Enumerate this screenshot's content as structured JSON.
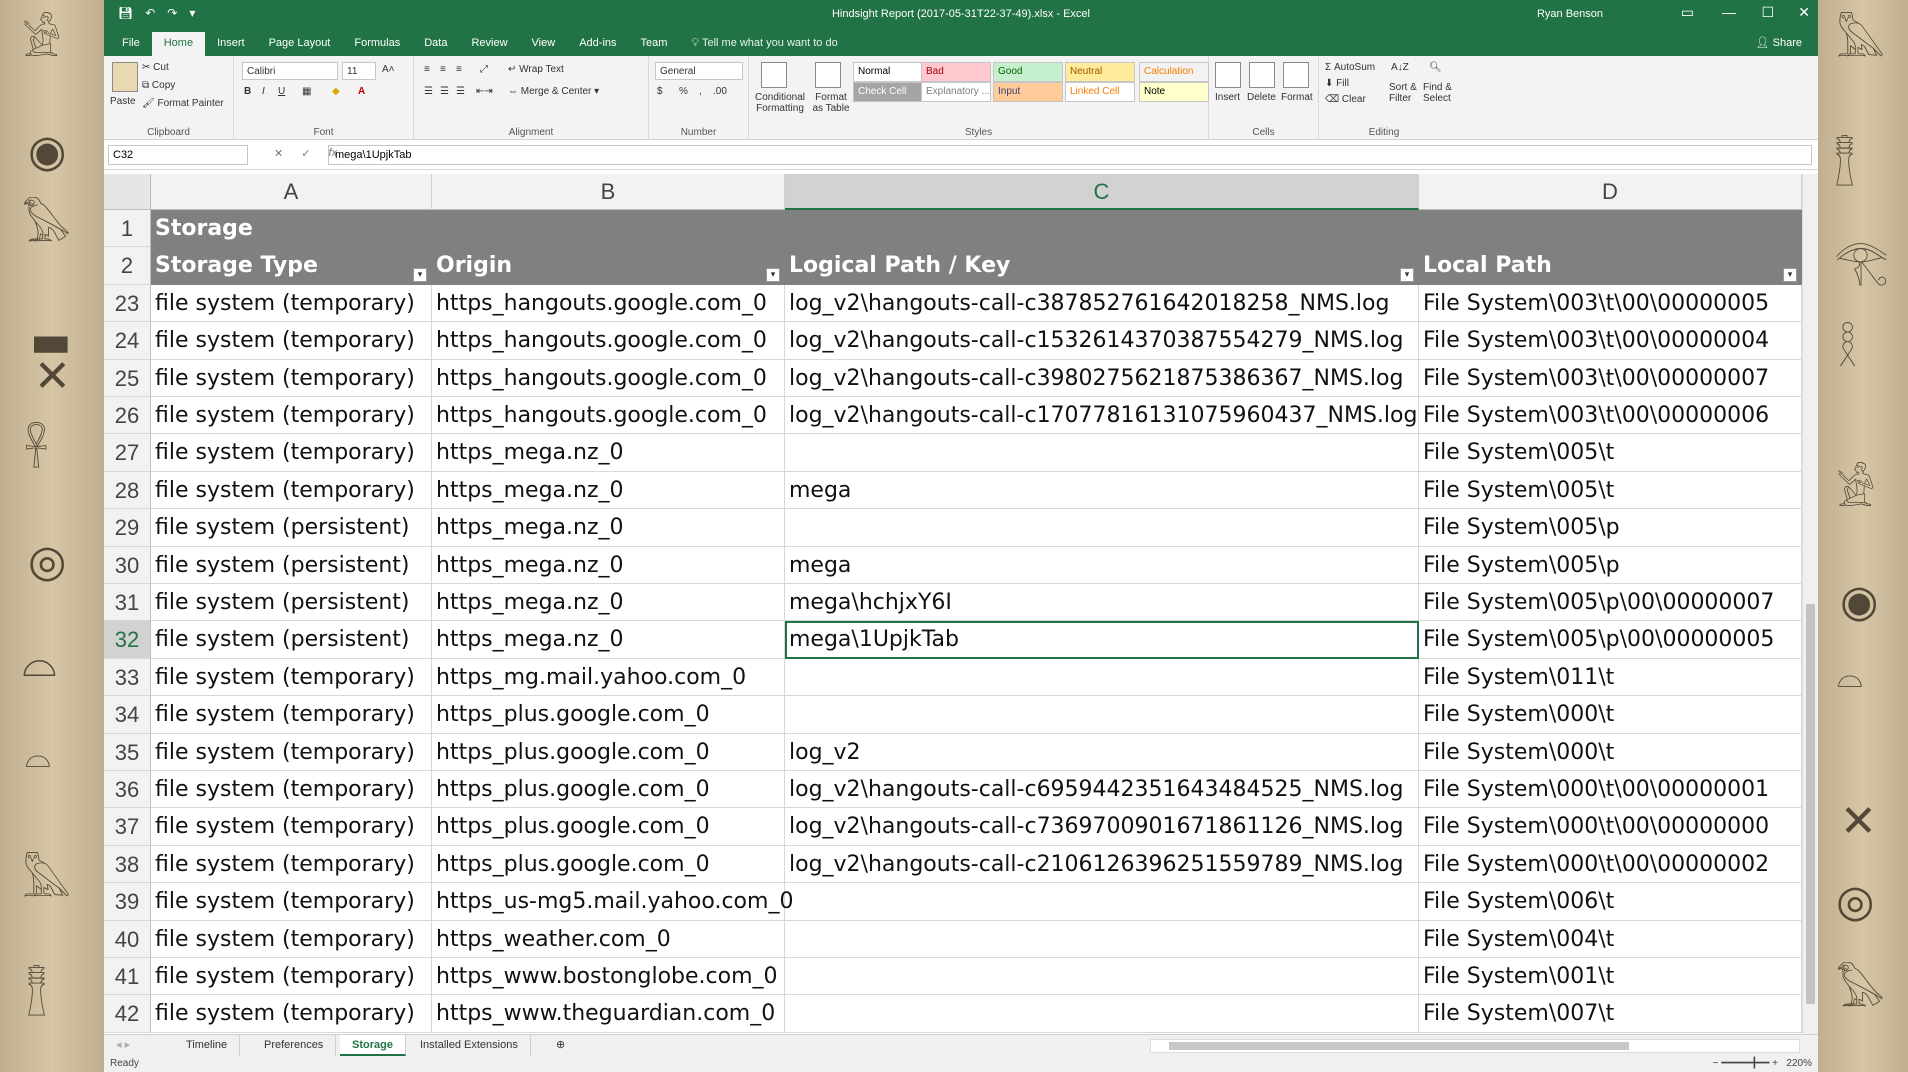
{
  "window": {
    "title": "Hindsight Report (2017-05-31T22-37-49).xlsx - Excel",
    "user": "Ryan Benson",
    "controls": [
      "—",
      "☐",
      "✕"
    ]
  },
  "ribbon_tabs": [
    "File",
    "Home",
    "Insert",
    "Page Layout",
    "Formulas",
    "Data",
    "Review",
    "View",
    "Add-ins",
    "Team"
  ],
  "tell_me": "Tell me what you want to do",
  "share": "Share",
  "clipboard": {
    "paste": "Paste",
    "cut": "Cut",
    "copy": "Copy",
    "format_painter": "Format Painter",
    "label": "Clipboard"
  },
  "font": {
    "name": "Calibri",
    "size": "11",
    "label": "Font",
    "bold": "B",
    "italic": "I",
    "underline": "U"
  },
  "alignment": {
    "wrap": "Wrap Text",
    "merge": "Merge & Center",
    "label": "Alignment"
  },
  "number": {
    "format": "General",
    "label": "Number",
    "currency": "$",
    "percent": "%"
  },
  "styles": {
    "label": "Styles",
    "conditional": "Conditional Formatting",
    "format_table": "Format as Table",
    "cells": [
      {
        "label": "Normal",
        "bg": "#ffffff",
        "color": "#000000"
      },
      {
        "label": "Bad",
        "bg": "#ffc7ce",
        "color": "#9c0006"
      },
      {
        "label": "Good",
        "bg": "#c6efce",
        "color": "#006100"
      },
      {
        "label": "Neutral",
        "bg": "#ffeb9c",
        "color": "#9c5700"
      },
      {
        "label": "Calculation",
        "bg": "#f2f2f2",
        "color": "#fa7d00"
      },
      {
        "label": "Check Cell",
        "bg": "#a5a5a5",
        "color": "#ffffff"
      },
      {
        "label": "Explanatory ...",
        "bg": "#ffffff",
        "color": "#7f7f7f"
      },
      {
        "label": "Input",
        "bg": "#ffcc99",
        "color": "#3f3f76"
      },
      {
        "label": "Linked Cell",
        "bg": "#ffffff",
        "color": "#fa7d00"
      },
      {
        "label": "Note",
        "bg": "#ffffcc",
        "color": "#000000"
      }
    ]
  },
  "cells_group": {
    "insert": "Insert",
    "delete": "Delete",
    "format": "Format",
    "label": "Cells"
  },
  "editing": {
    "autosum": "AutoSum",
    "fill": "Fill",
    "clear": "Clear",
    "sort": "Sort & Filter",
    "find": "Find & Select",
    "label": "Editing"
  },
  "formula_bar": {
    "name_box": "C32",
    "fx": "fx",
    "content": "mega\\1UpjkTab"
  },
  "columns": [
    "A",
    "B",
    "C",
    "D"
  ],
  "selected_column": "C",
  "sheet_title": "Storage",
  "headers": [
    "Storage Type",
    "Origin",
    "Logical Path / Key",
    "Local Path"
  ],
  "rows": [
    {
      "n": "23",
      "a": "file system (temporary)",
      "b": "https_hangouts.google.com_0",
      "c": "log_v2\\hangouts-call-c387852761642018258_NMS.log",
      "d": "File System\\003\\t\\00\\00000005"
    },
    {
      "n": "24",
      "a": "file system (temporary)",
      "b": "https_hangouts.google.com_0",
      "c": "log_v2\\hangouts-call-c1532614370387554279_NMS.log",
      "d": "File System\\003\\t\\00\\00000004"
    },
    {
      "n": "25",
      "a": "file system (temporary)",
      "b": "https_hangouts.google.com_0",
      "c": "log_v2\\hangouts-call-c3980275621875386367_NMS.log",
      "d": "File System\\003\\t\\00\\00000007"
    },
    {
      "n": "26",
      "a": "file system (temporary)",
      "b": "https_hangouts.google.com_0",
      "c": "log_v2\\hangouts-call-c17077816131075960437_NMS.log",
      "d": "File System\\003\\t\\00\\00000006"
    },
    {
      "n": "27",
      "a": "file system (temporary)",
      "b": "https_mega.nz_0",
      "c": "",
      "d": "File System\\005\\t"
    },
    {
      "n": "28",
      "a": "file system (temporary)",
      "b": "https_mega.nz_0",
      "c": "mega",
      "d": "File System\\005\\t"
    },
    {
      "n": "29",
      "a": "file system (persistent)",
      "b": "https_mega.nz_0",
      "c": "",
      "d": "File System\\005\\p"
    },
    {
      "n": "30",
      "a": "file system (persistent)",
      "b": "https_mega.nz_0",
      "c": "mega",
      "d": "File System\\005\\p"
    },
    {
      "n": "31",
      "a": "file system (persistent)",
      "b": "https_mega.nz_0",
      "c": "mega\\hchjxY6I",
      "d": "File System\\005\\p\\00\\00000007"
    },
    {
      "n": "32",
      "a": "file system (persistent)",
      "b": "https_mega.nz_0",
      "c": "mega\\1UpjkTab",
      "d": "File System\\005\\p\\00\\00000005"
    },
    {
      "n": "33",
      "a": "file system (temporary)",
      "b": "https_mg.mail.yahoo.com_0",
      "c": "",
      "d": "File System\\011\\t"
    },
    {
      "n": "34",
      "a": "file system (temporary)",
      "b": "https_plus.google.com_0",
      "c": "",
      "d": "File System\\000\\t"
    },
    {
      "n": "35",
      "a": "file system (temporary)",
      "b": "https_plus.google.com_0",
      "c": "log_v2",
      "d": "File System\\000\\t"
    },
    {
      "n": "36",
      "a": "file system (temporary)",
      "b": "https_plus.google.com_0",
      "c": "log_v2\\hangouts-call-c6959442351643484525_NMS.log",
      "d": "File System\\000\\t\\00\\00000001"
    },
    {
      "n": "37",
      "a": "file system (temporary)",
      "b": "https_plus.google.com_0",
      "c": "log_v2\\hangouts-call-c7369700901671861126_NMS.log",
      "d": "File System\\000\\t\\00\\00000000"
    },
    {
      "n": "38",
      "a": "file system (temporary)",
      "b": "https_plus.google.com_0",
      "c": "log_v2\\hangouts-call-c2106126396251559789_NMS.log",
      "d": "File System\\000\\t\\00\\00000002"
    },
    {
      "n": "39",
      "a": "file system (temporary)",
      "b": "https_us-mg5.mail.yahoo.com_0",
      "c": "",
      "d": "File System\\006\\t"
    },
    {
      "n": "40",
      "a": "file system (temporary)",
      "b": "https_weather.com_0",
      "c": "",
      "d": "File System\\004\\t"
    },
    {
      "n": "41",
      "a": "file system (temporary)",
      "b": "https_www.bostonglobe.com_0",
      "c": "",
      "d": "File System\\001\\t"
    },
    {
      "n": "42",
      "a": "file system (temporary)",
      "b": "https_www.theguardian.com_0",
      "c": "",
      "d": "File System\\007\\t"
    }
  ],
  "selected_row": "32",
  "sheet_tabs": [
    "Timeline",
    "Preferences",
    "Storage",
    "Installed Extensions"
  ],
  "active_sheet": "Storage",
  "status": "Ready",
  "zoom": "220%",
  "colors": {
    "accent": "#217346",
    "header_bg": "#808080"
  }
}
